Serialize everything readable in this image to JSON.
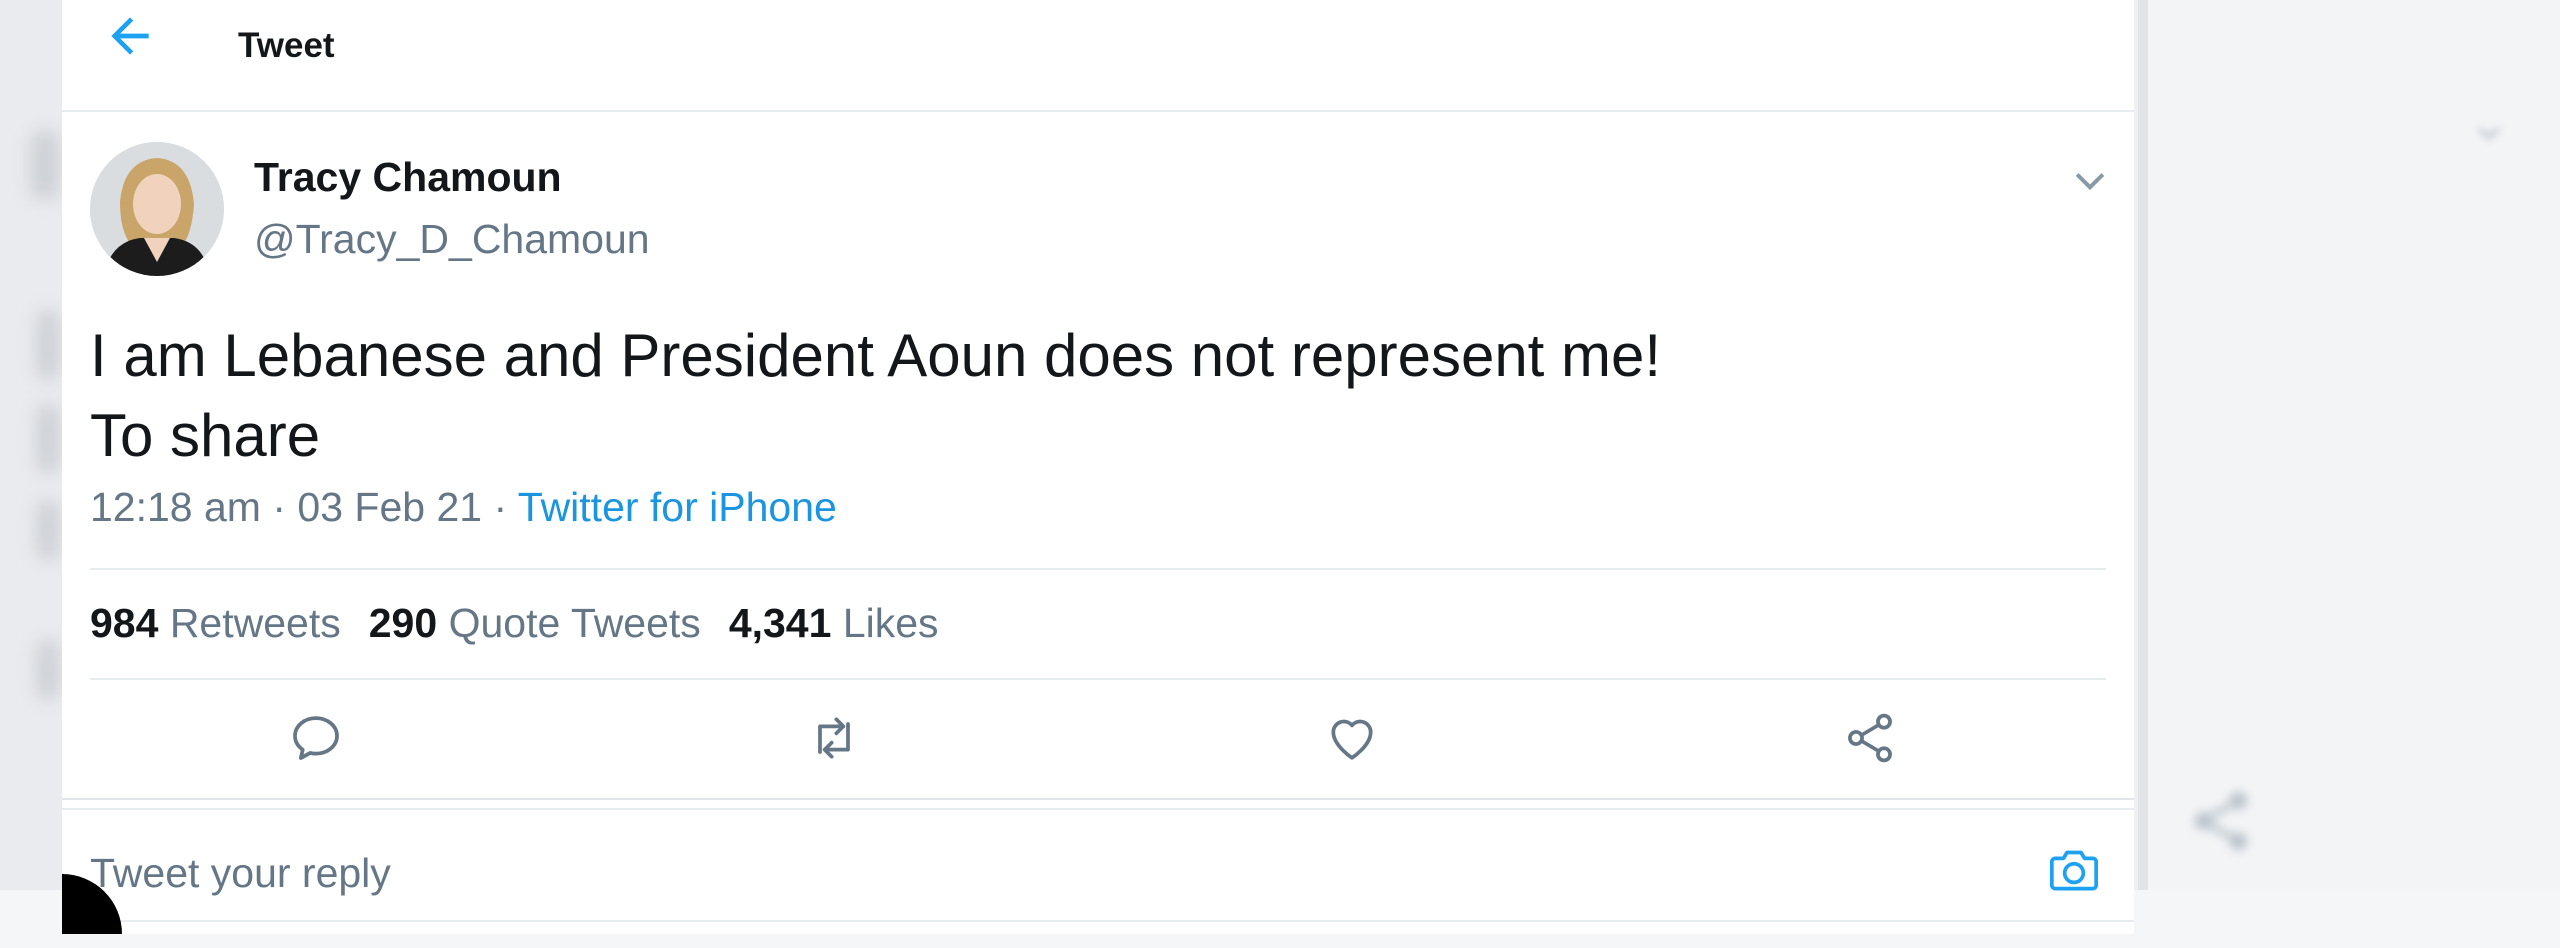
{
  "header": {
    "title": "Tweet",
    "back_icon": "arrow-left-icon"
  },
  "tweet": {
    "author_name": "Tracy Chamoun",
    "author_handle": "@Tracy_D_Chamoun",
    "text": "I am Lebanese and President Aoun does not represent me!\nTo share",
    "time": "12:18 am",
    "date": "03 Feb 21",
    "separator": "·",
    "source": "Twitter for iPhone",
    "stats": [
      {
        "count": "984",
        "label": "Retweets"
      },
      {
        "count": "290",
        "label": "Quote Tweets"
      },
      {
        "count": "4,341",
        "label": "Likes"
      }
    ],
    "actions": [
      "reply-icon",
      "retweet-icon",
      "like-icon",
      "share-icon"
    ]
  },
  "reply": {
    "placeholder": "Tweet your reply",
    "camera_icon": "camera-icon"
  },
  "colors": {
    "accent": "#1b95e0",
    "secondary_text": "#657786",
    "primary_text": "#14171a"
  }
}
